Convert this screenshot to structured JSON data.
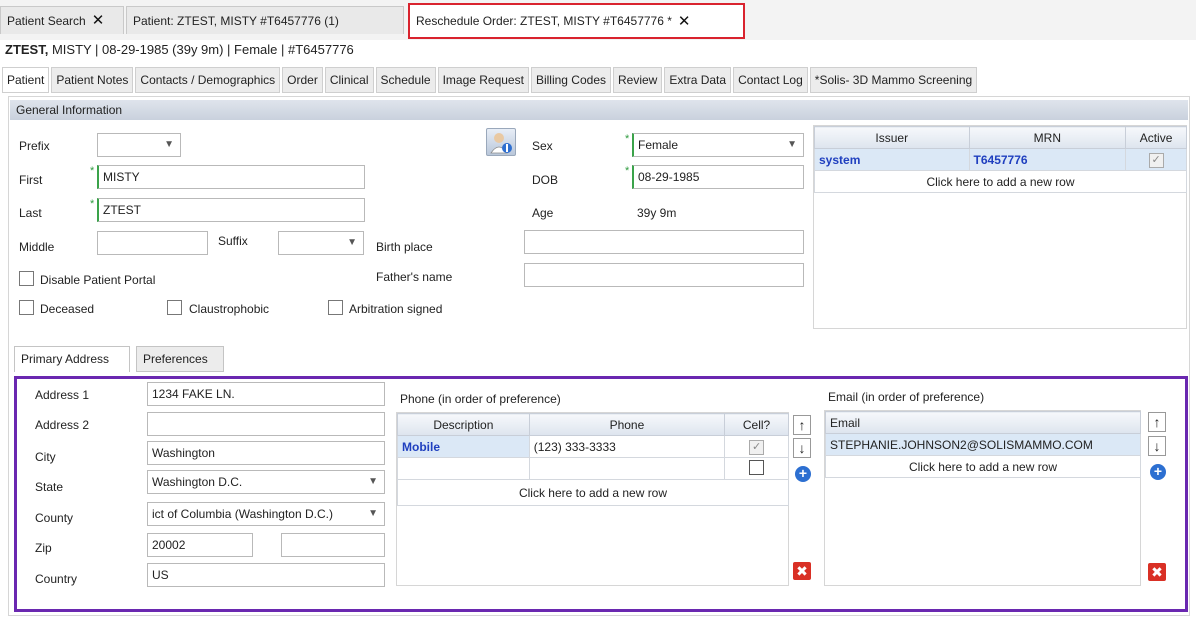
{
  "doc_tabs": [
    {
      "label": "Patient Search"
    },
    {
      "label": "Patient: ZTEST, MISTY #T6457776 (1)"
    },
    {
      "label": "Reschedule Order: ZTEST, MISTY #T6457776 *"
    }
  ],
  "header": {
    "last": "ZTEST,",
    "rest": " MISTY  |  08-29-1985 (39y 9m)  |  Female  |  #T6457776"
  },
  "section_tabs": [
    "Patient",
    "Patient Notes",
    "Contacts / Demographics",
    "Order",
    "Clinical",
    "Schedule",
    "Image Request",
    "Billing Codes",
    "Review",
    "Extra Data",
    "Contact Log",
    "*Solis- 3D Mammo Screening"
  ],
  "general": {
    "title": "General Information",
    "prefix_label": "Prefix",
    "prefix_value": "",
    "first_label": "First",
    "first_value": "MISTY",
    "last_label": "Last",
    "last_value": "ZTEST",
    "middle_label": "Middle",
    "middle_value": "",
    "suffix_label": "Suffix",
    "suffix_value": "",
    "sex_label": "Sex",
    "sex_value": "Female",
    "dob_label": "DOB",
    "dob_value": "08-29-1985",
    "age_label": "Age",
    "age_value": "39y 9m",
    "birthplace_label": "Birth place",
    "birthplace_value": "",
    "father_label": "Father's name",
    "father_value": "",
    "disable_portal_label": "Disable Patient Portal",
    "deceased_label": "Deceased",
    "claustro_label": "Claustrophobic",
    "arbitration_label": "Arbitration signed"
  },
  "mrn_table": {
    "headers": [
      "Issuer",
      "MRN",
      "Active"
    ],
    "rows": [
      {
        "issuer": "system",
        "mrn": "T6457776",
        "active": true
      }
    ],
    "add_row": "Click here to add a new row"
  },
  "sub_tabs": [
    "Primary Address",
    "Preferences"
  ],
  "address": {
    "addr1_label": "Address 1",
    "addr1_value": "1234 FAKE LN.",
    "addr2_label": "Address 2",
    "addr2_value": "",
    "city_label": "City",
    "city_value": "Washington",
    "state_label": "State",
    "state_value": "Washington D.C.",
    "county_label": "County",
    "county_value": "ict of Columbia (Washington D.C.)",
    "zip_label": "Zip",
    "zip_value": "20002",
    "zip_ext_value": "",
    "country_label": "Country",
    "country_value": "US"
  },
  "phone": {
    "title": "Phone (in order of preference)",
    "headers": [
      "Description",
      "Phone",
      "Cell?"
    ],
    "rows": [
      {
        "description": "Mobile",
        "phone": "(123) 333-3333",
        "cell": true
      }
    ],
    "add_row": "Click here to add a new row"
  },
  "email": {
    "title": "Email (in order of preference)",
    "header": "Email",
    "rows": [
      "STEPHANIE.JOHNSON2@SOLISMAMMO.COM"
    ],
    "add_row": "Click here to add a new row"
  },
  "colors": {
    "highlight_red": "#d9232e",
    "highlight_purple": "#6a28b0",
    "link_blue": "#1f3fbf"
  }
}
